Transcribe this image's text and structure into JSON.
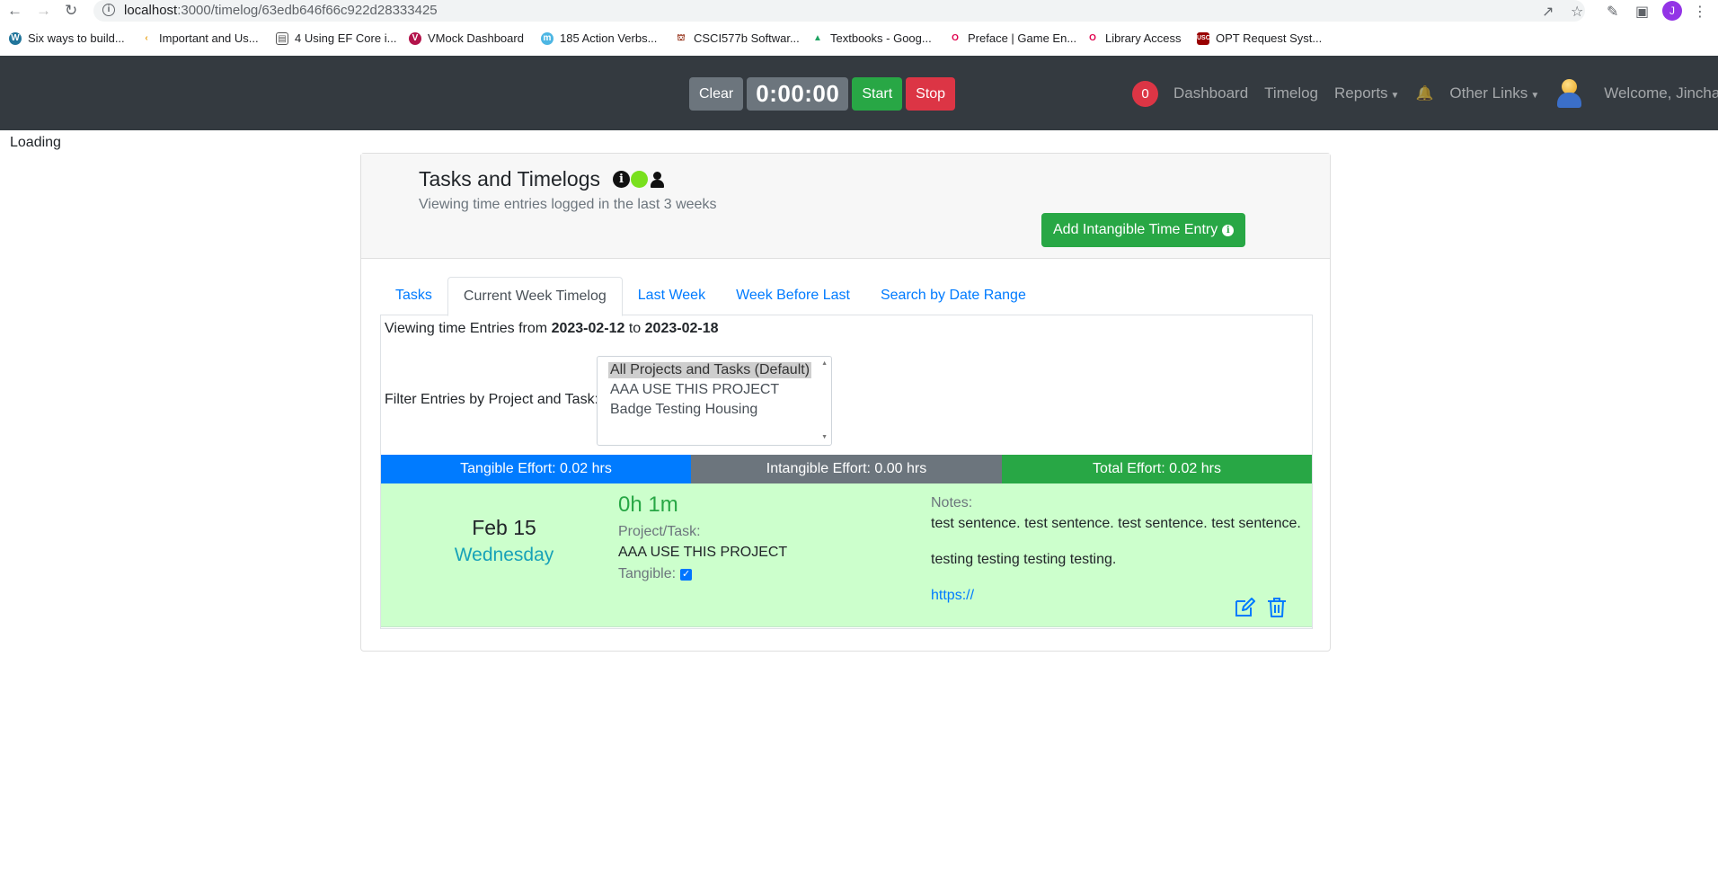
{
  "browser": {
    "url_host": "localhost",
    "url_path": ":3000/timelog/63edb646f66c922d28333425",
    "avatar_letter": "J",
    "bookmarks": [
      {
        "label": "Six ways to build..."
      },
      {
        "label": "Important and Us..."
      },
      {
        "label": "4 Using EF Core i..."
      },
      {
        "label": "VMock Dashboard"
      },
      {
        "label": "185 Action Verbs..."
      },
      {
        "label": "CSCI577b Softwar..."
      },
      {
        "label": "Textbooks - Goog..."
      },
      {
        "label": "Preface | Game En..."
      },
      {
        "label": "Library Access"
      },
      {
        "label": "OPT Request Syst..."
      }
    ]
  },
  "navbar": {
    "clear_label": "Clear",
    "timer_value": "0:00:00",
    "start_label": "Start",
    "stop_label": "Stop",
    "notification_count": "0",
    "links": {
      "dashboard": "Dashboard",
      "timelog": "Timelog",
      "reports": "Reports",
      "other_links": "Other Links",
      "welcome": "Welcome, Jinchao"
    }
  },
  "loading_text": "Loading",
  "card": {
    "title": "Tasks and Timelogs",
    "subtitle": "Viewing time entries logged in the last 3 weeks",
    "add_button": "Add Intangible Time Entry"
  },
  "tabs": [
    {
      "label": "Tasks"
    },
    {
      "label": "Current Week Timelog"
    },
    {
      "label": "Last Week"
    },
    {
      "label": "Week Before Last"
    },
    {
      "label": "Search by Date Range"
    }
  ],
  "range": {
    "prefix": "Viewing time Entries from",
    "start": "2023-02-12",
    "middle": "to",
    "end": "2023-02-18"
  },
  "filter": {
    "label": "Filter Entries by Project and Task:",
    "options": [
      "All Projects and Tasks (Default)",
      "AAA USE THIS PROJECT",
      "Badge Testing Housing"
    ],
    "selected": "All Projects and Tasks (Default)"
  },
  "effort": {
    "tangible": "Tangible Effort: 0.02 hrs",
    "intangible": "Intangible Effort: 0.00 hrs",
    "total": "Total Effort: 0.02 hrs"
  },
  "entry": {
    "date": "Feb 15",
    "weekday": "Wednesday",
    "duration": "0h 1m",
    "project_label": "Project/Task:",
    "project": "AAA USE THIS PROJECT",
    "tangible_label": "Tangible:",
    "tangible": true,
    "notes_label": "Notes:",
    "note_line1": "test sentence. test sentence. test sentence. test sentence.",
    "note_line2": "testing testing testing testing.",
    "note_link": "https://"
  },
  "colors": {
    "navbar": "#343a40",
    "primary": "#007bff",
    "success": "#28a745",
    "danger": "#dc3545",
    "secondary": "#6c757d",
    "entry_bg": "#ccffcc"
  }
}
